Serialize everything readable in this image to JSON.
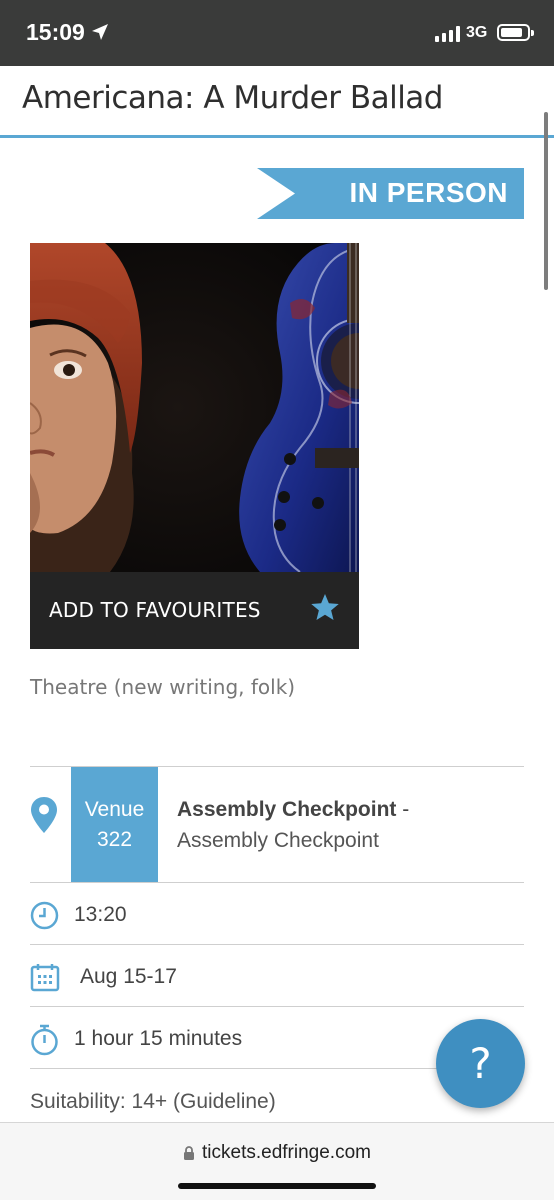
{
  "status_bar": {
    "time": "15:09",
    "network": "3G"
  },
  "header": {
    "title": "Americana: A Murder Ballad"
  },
  "badge": {
    "label": "IN PERSON"
  },
  "show": {
    "favourites_label": "ADD TO FAVOURITES",
    "genre": "Theatre (new writing, folk)"
  },
  "details": {
    "venue_label": "Venue",
    "venue_number": "322",
    "venue_name": "Assembly Checkpoint",
    "venue_dash": " -",
    "venue_sub": "Assembly Checkpoint",
    "time": "13:20",
    "dates": "Aug 15-17",
    "duration": "1 hour 15 minutes",
    "suitability": "Suitability: 14+ (Guideline)"
  },
  "help": {
    "label": "?"
  },
  "browser": {
    "url": "tickets.edfringe.com"
  },
  "colors": {
    "accent": "#5aa7d3",
    "help_button": "#3f8fc1",
    "status_bar": "#3a3b3a"
  }
}
